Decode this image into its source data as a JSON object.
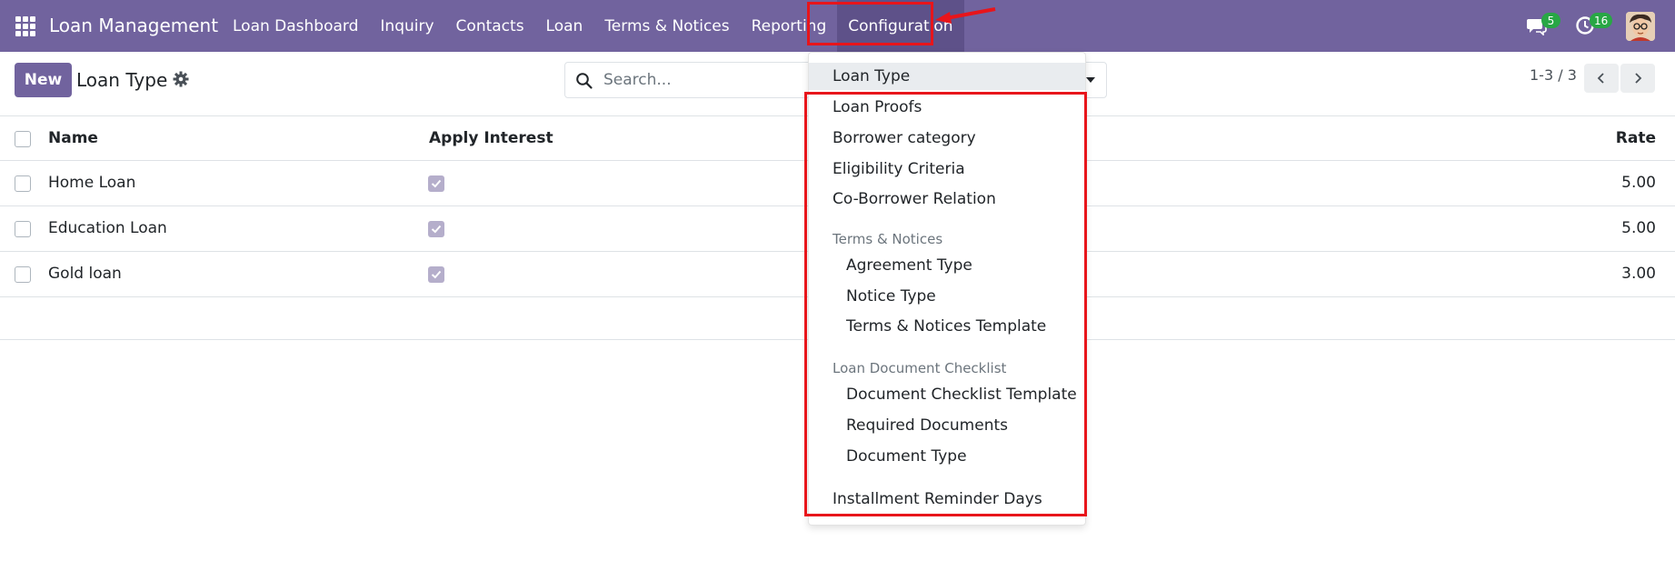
{
  "navbar": {
    "brand": "Loan Management",
    "menu": [
      "Loan Dashboard",
      "Inquiry",
      "Contacts",
      "Loan",
      "Terms & Notices",
      "Reporting",
      "Configuration"
    ],
    "active_menu": "Configuration",
    "messages_count": "5",
    "activities_count": "16",
    "color": "#71639e"
  },
  "control_panel": {
    "new_button": "New",
    "title": "Loan Type",
    "search_placeholder": "Search...",
    "pager": "1-3 / 3"
  },
  "table": {
    "headers": {
      "name": "Name",
      "apply_interest": "Apply Interest",
      "rate": "Rate"
    },
    "rows": [
      {
        "name": "Home Loan",
        "apply_interest": true,
        "rate": "5.00"
      },
      {
        "name": "Education Loan",
        "apply_interest": true,
        "rate": "5.00"
      },
      {
        "name": "Gold loan",
        "apply_interest": true,
        "rate": "3.00"
      }
    ]
  },
  "config_menu": {
    "items": [
      "Loan Type",
      "Loan Proofs",
      "Borrower category",
      "Eligibility Criteria",
      "Co-Borrower Relation"
    ],
    "terms_header": "Terms & Notices",
    "terms_items": [
      "Agreement Type",
      "Notice Type",
      "Terms & Notices Template"
    ],
    "checklist_header": "Loan Document Checklist",
    "checklist_items": [
      "Document Checklist Template",
      "Required Documents",
      "Document Type"
    ],
    "last_item": "Installment Reminder Days"
  },
  "annotation_color": "#e8151b"
}
